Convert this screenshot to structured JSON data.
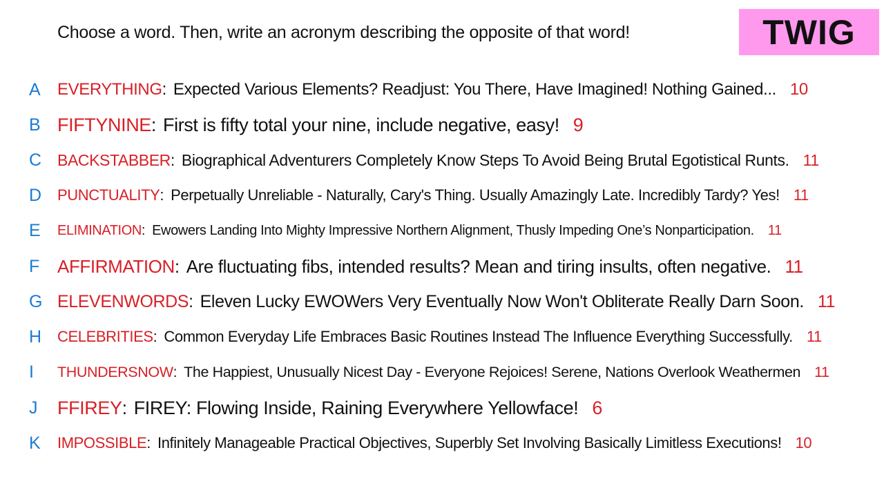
{
  "header": {
    "prompt": "Choose a word. Then, write an acronym describing the opposite of that word!",
    "badge_text": "TWIG"
  },
  "colors": {
    "badge_bg": "#ff99ee",
    "word": "#d81f26",
    "letter": "#1a7bd6",
    "text": "#111111"
  },
  "entries": [
    {
      "letter": "A",
      "word": "EVERYTHING",
      "acronym": "Expected Various Elements? Readjust: You There, Have Imagined! Nothing Gained...",
      "count": "10"
    },
    {
      "letter": "B",
      "word": "FIFTYNINE",
      "acronym": "First is fifty total your nine, include negative, easy!",
      "count": "9"
    },
    {
      "letter": "C",
      "word": "BACKSTABBER",
      "acronym": "Biographical Adventurers Completely Know Steps To Avoid Being Brutal Egotistical Runts.",
      "count": "11"
    },
    {
      "letter": "D",
      "word": "PUNCTUALITY",
      "acronym": "Perpetually Unreliable - Naturally, Cary's Thing. Usually Amazingly Late. Incredibly Tardy? Yes!",
      "count": "11"
    },
    {
      "letter": "E",
      "word": "ELIMINATION",
      "acronym": "Ewowers Landing Into Mighty Impressive Northern Alignment, Thusly Impeding One’s Nonparticipation.",
      "count": "11"
    },
    {
      "letter": "F",
      "word": "AFFIRMATION",
      "acronym": "Are fluctuating fibs, intended results? Mean and tiring insults, often negative.",
      "count": "11"
    },
    {
      "letter": "G",
      "word": "ELEVENWORDS",
      "acronym": "Eleven Lucky EWOWers Very Eventually Now Won't Obliterate Really Darn Soon.",
      "count": "11"
    },
    {
      "letter": "H",
      "word": "CELEBRITIES",
      "acronym": "Common Everyday Life Embraces Basic Routines Instead The Influence Everything Successfully.",
      "count": "11"
    },
    {
      "letter": "I",
      "word": "THUNDERSNOW",
      "acronym": "The Happiest, Unusually Nicest Day - Everyone Rejoices! Serene, Nations Overlook Weathermen",
      "count": "11"
    },
    {
      "letter": "J",
      "word": "FFIREY",
      "acronym": "FIREY: Flowing Inside, Raining Everywhere Yellowface!",
      "count": "6"
    },
    {
      "letter": "K",
      "word": "IMPOSSIBLE",
      "acronym": "Infinitely Manageable Practical Objectives, Superbly Set Involving Basically Limitless Executions!",
      "count": "10"
    }
  ]
}
